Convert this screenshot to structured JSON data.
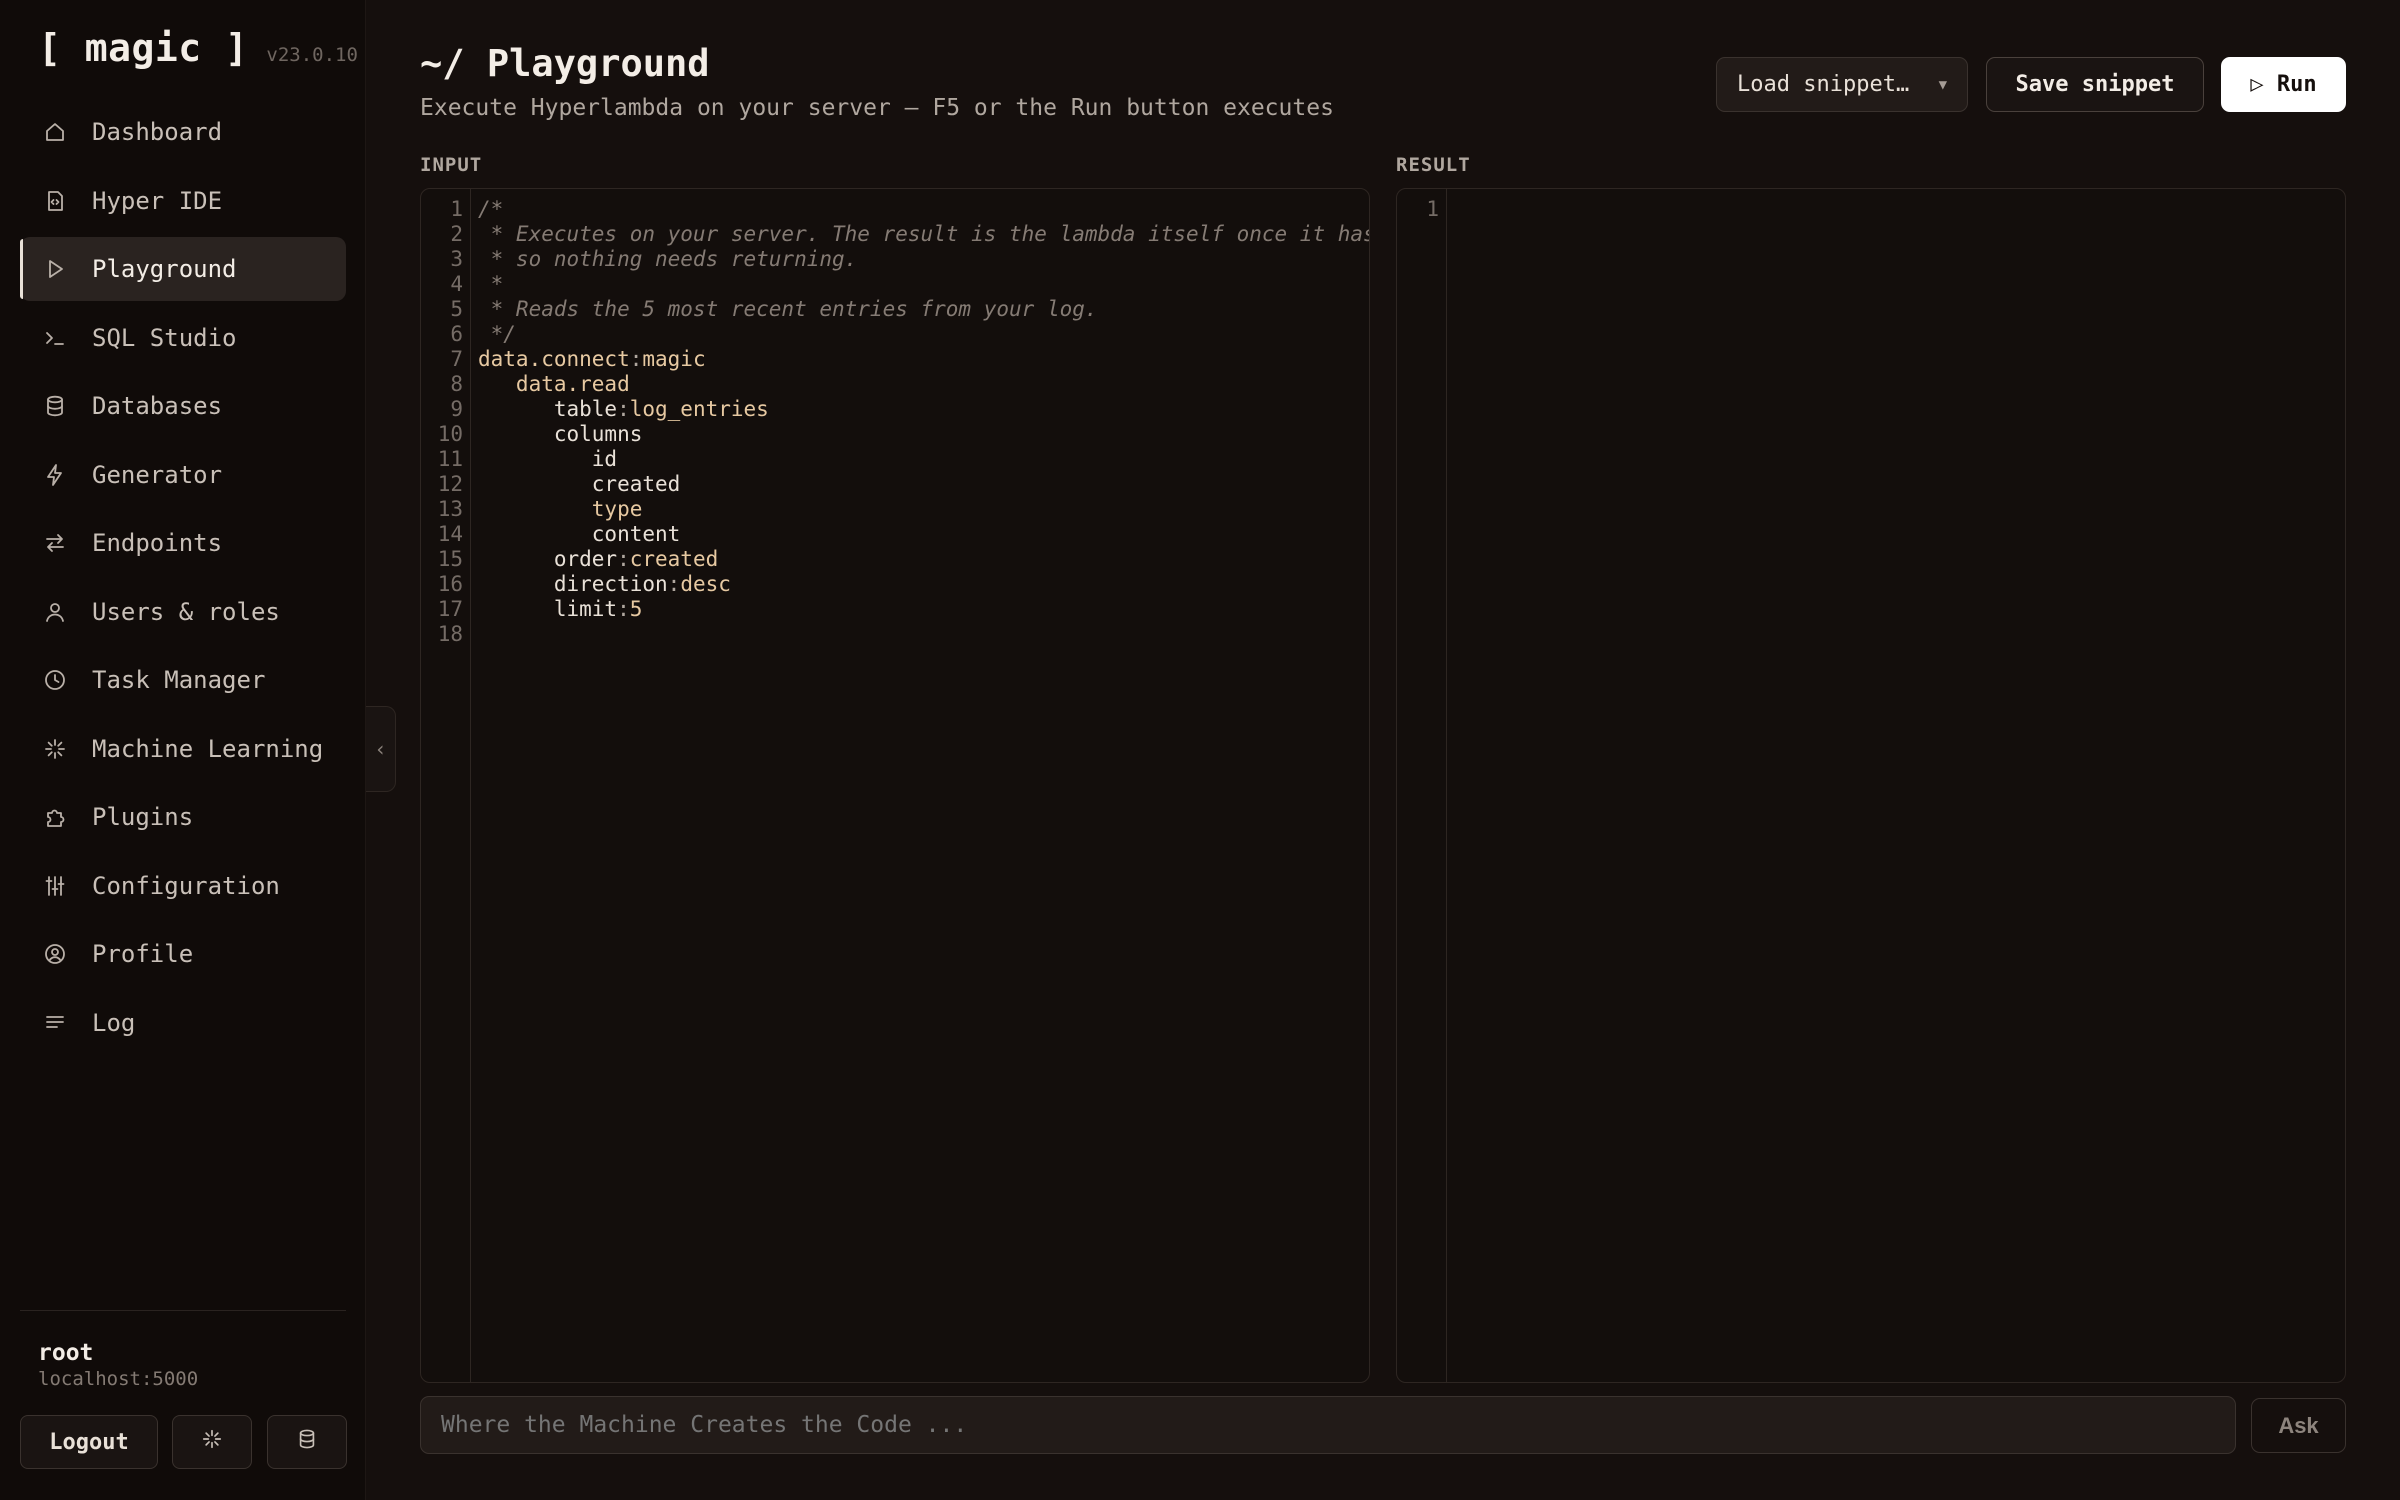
{
  "app": {
    "logo": "[ magic ]",
    "version": "v23.0.10"
  },
  "sidebar": {
    "items": [
      {
        "label": "Dashboard",
        "icon": "home-icon"
      },
      {
        "label": "Hyper IDE",
        "icon": "code-file-icon"
      },
      {
        "label": "Playground",
        "icon": "play-icon",
        "active": true
      },
      {
        "label": "SQL Studio",
        "icon": "terminal-icon"
      },
      {
        "label": "Databases",
        "icon": "database-icon"
      },
      {
        "label": "Generator",
        "icon": "bolt-icon"
      },
      {
        "label": "Endpoints",
        "icon": "arrows-icon"
      },
      {
        "label": "Users & roles",
        "icon": "user-icon"
      },
      {
        "label": "Task Manager",
        "icon": "clock-icon"
      },
      {
        "label": "Machine Learning",
        "icon": "sparkle-icon"
      },
      {
        "label": "Plugins",
        "icon": "puzzle-icon"
      },
      {
        "label": "Configuration",
        "icon": "sliders-icon"
      },
      {
        "label": "Profile",
        "icon": "user-circle-icon"
      },
      {
        "label": "Log",
        "icon": "lines-icon"
      }
    ],
    "user": {
      "name": "root",
      "host": "localhost:5000"
    },
    "logout_label": "Logout"
  },
  "header": {
    "title": "~/ Playground",
    "subtitle": "Execute Hyperlambda on your server — F5 or the Run button executes",
    "load_snippet": "Load snippet…",
    "save_snippet": "Save snippet",
    "run": "▷ Run"
  },
  "input": {
    "label": "INPUT",
    "lines": [
      [
        [
          "comment",
          "/*"
        ]
      ],
      [
        [
          "comment",
          " * Executes on your server. The result is the lambda itself once it has executed,"
        ]
      ],
      [
        [
          "comment",
          " * so nothing needs returning."
        ]
      ],
      [
        [
          "comment",
          " *"
        ]
      ],
      [
        [
          "comment",
          " * Reads the 5 most recent entries from your log."
        ]
      ],
      [
        [
          "comment",
          " */"
        ]
      ],
      [
        [
          "key",
          "data.connect"
        ],
        [
          "punct",
          ":"
        ],
        [
          "val",
          "magic"
        ]
      ],
      [
        [
          "key",
          "   data.read"
        ]
      ],
      [
        [
          "plain",
          "      table"
        ],
        [
          "punct",
          ":"
        ],
        [
          "val",
          "log_entries"
        ]
      ],
      [
        [
          "plain",
          "      columns"
        ]
      ],
      [
        [
          "plain",
          "         id"
        ]
      ],
      [
        [
          "plain",
          "         created"
        ]
      ],
      [
        [
          "key",
          "         type"
        ]
      ],
      [
        [
          "plain",
          "         content"
        ]
      ],
      [
        [
          "plain",
          "      order"
        ],
        [
          "punct",
          ":"
        ],
        [
          "val",
          "created"
        ]
      ],
      [
        [
          "plain",
          "      direction"
        ],
        [
          "punct",
          ":"
        ],
        [
          "val",
          "desc"
        ]
      ],
      [
        [
          "plain",
          "      limit"
        ],
        [
          "punct",
          ":"
        ],
        [
          "val",
          "5"
        ]
      ],
      [
        [
          "plain",
          ""
        ]
      ]
    ]
  },
  "result": {
    "label": "RESULT",
    "line_count": 1
  },
  "ask": {
    "placeholder": "Where the Machine Creates the Code ...",
    "button": "Ask"
  },
  "colors": {
    "background": "#150f0d",
    "sidebar": "#100b09",
    "accent_key": "#e7c9a2",
    "comment": "#857b74"
  }
}
